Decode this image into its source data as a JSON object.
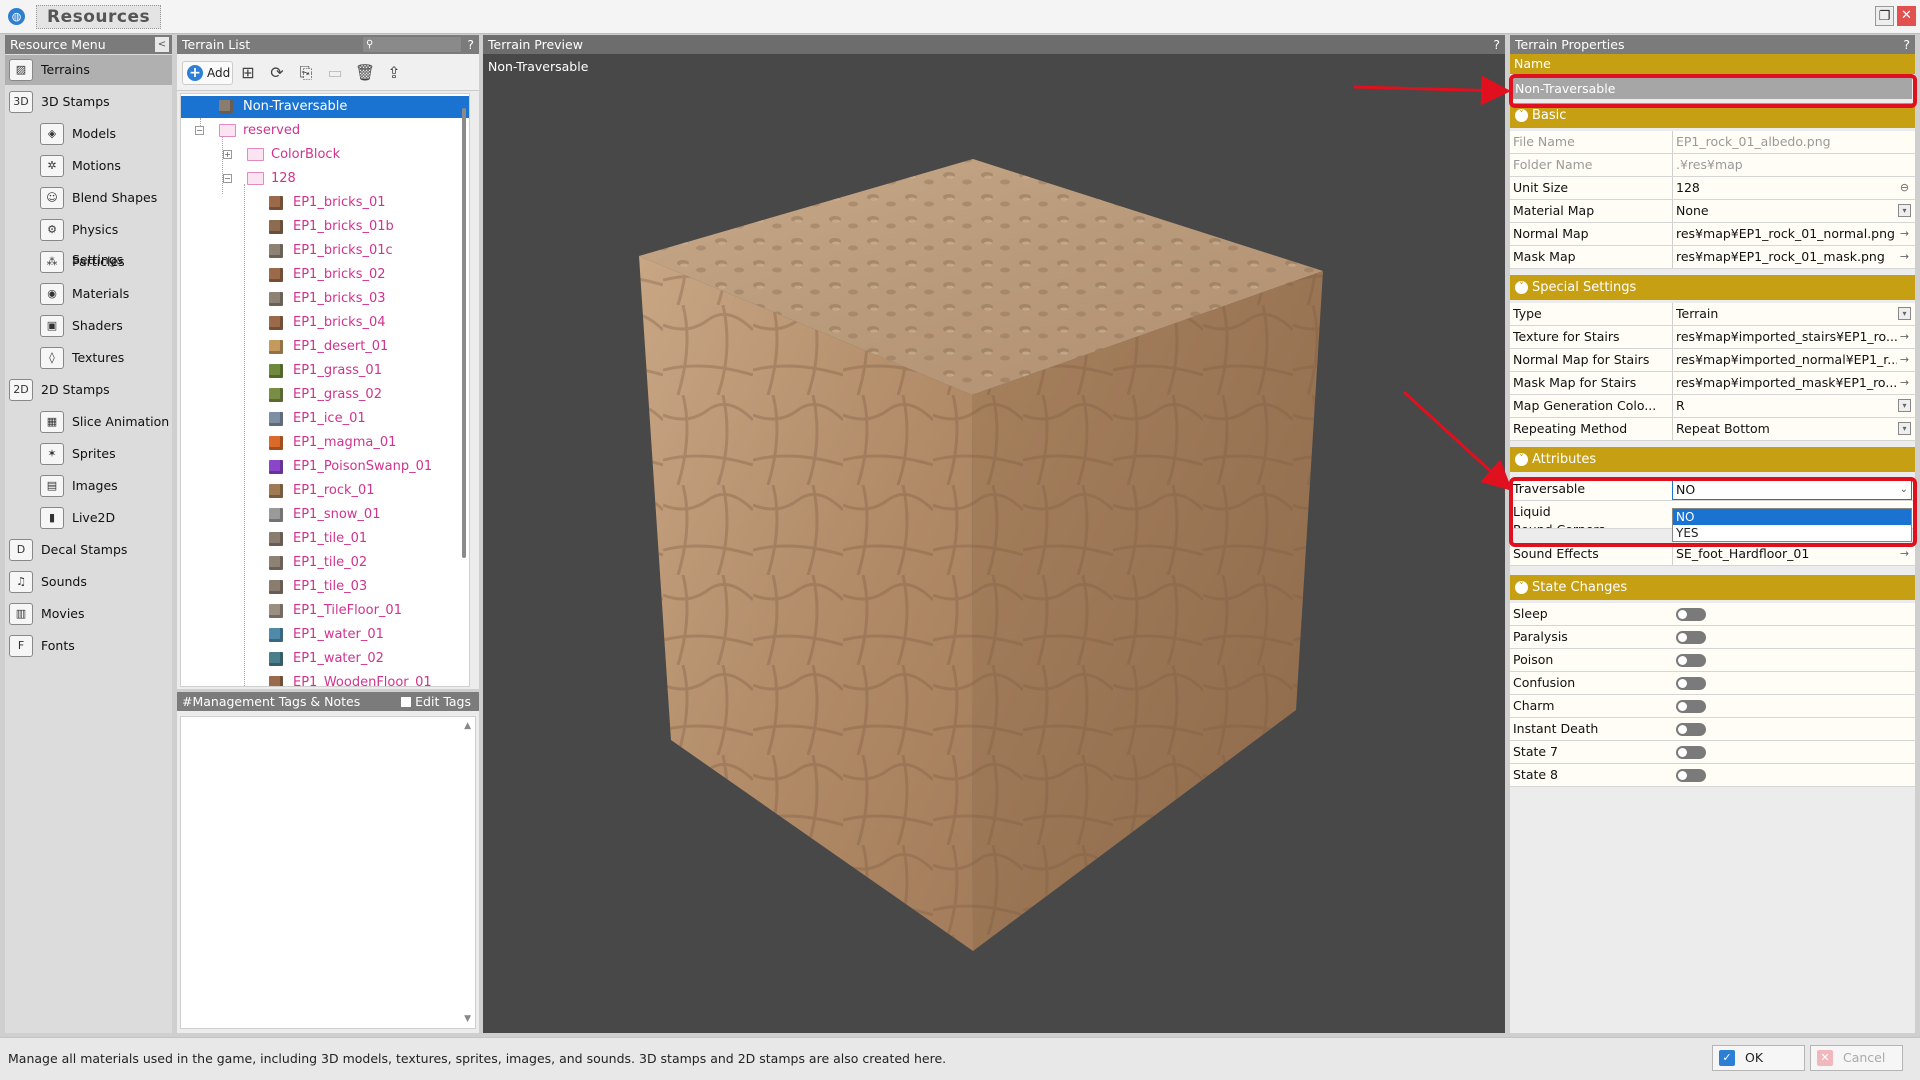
{
  "window": {
    "title": "Resources",
    "app_icon": "globe-icon",
    "restore_icon": "restore-icon",
    "close_icon": "close-icon"
  },
  "resource_menu": {
    "header": "Resource Menu",
    "collapse_glyph": "<",
    "items": [
      {
        "label": "Terrains",
        "glyph": "▨",
        "active": true
      },
      {
        "label": "3D Stamps",
        "glyph": "3D"
      },
      {
        "label": "Models",
        "glyph": "◈"
      },
      {
        "label": "Motions",
        "glyph": "✲"
      },
      {
        "label": "Blend Shapes",
        "glyph": "☺"
      },
      {
        "label": "Physics Settings",
        "glyph": "⚙"
      },
      {
        "label": "Particles",
        "glyph": "⁂"
      },
      {
        "label": "Materials",
        "glyph": "◉"
      },
      {
        "label": "Shaders",
        "glyph": "▣"
      },
      {
        "label": "Textures",
        "glyph": "◊"
      },
      {
        "label": "2D Stamps",
        "glyph": "2D"
      },
      {
        "label": "Slice Animation",
        "glyph": "▦"
      },
      {
        "label": "Sprites",
        "glyph": "✶"
      },
      {
        "label": "Images",
        "glyph": "▤"
      },
      {
        "label": "Live2D",
        "glyph": "▮"
      },
      {
        "label": "Decal Stamps",
        "glyph": "D"
      },
      {
        "label": "Sounds",
        "glyph": "♫"
      },
      {
        "label": "Movies",
        "glyph": "▥"
      },
      {
        "label": "Fonts",
        "glyph": "F"
      }
    ]
  },
  "terrain_list": {
    "header": "Terrain List",
    "help": "?",
    "search_glyph": "⚲",
    "add_label": "Add",
    "add_glyph": "+",
    "toolbar_glyphs": [
      "⊞",
      "⟳",
      "⎘",
      "▭",
      "🗑",
      "⇪"
    ],
    "rows": [
      {
        "label": "Non-Traversable",
        "kind": "item",
        "color": "#8a7d70",
        "selected": true
      },
      {
        "label": "reserved",
        "kind": "folder",
        "expander": "−"
      },
      {
        "label": "ColorBlock",
        "kind": "folder",
        "expander": "+"
      },
      {
        "label": "128",
        "kind": "folder",
        "expander": "−"
      },
      {
        "label": "EP1_bricks_01",
        "kind": "item",
        "color": "#9a6a4a"
      },
      {
        "label": "EP1_bricks_01b",
        "kind": "item",
        "color": "#8d6b50"
      },
      {
        "label": "EP1_bricks_01c",
        "kind": "item",
        "color": "#8e8275"
      },
      {
        "label": "EP1_bricks_02",
        "kind": "item",
        "color": "#9a6a4a"
      },
      {
        "label": "EP1_bricks_03",
        "kind": "item",
        "color": "#8e8275"
      },
      {
        "label": "EP1_bricks_04",
        "kind": "item",
        "color": "#9a6a4a"
      },
      {
        "label": "EP1_desert_01",
        "kind": "item",
        "color": "#c49a5e"
      },
      {
        "label": "EP1_grass_01",
        "kind": "item",
        "color": "#6f8a3c"
      },
      {
        "label": "EP1_grass_02",
        "kind": "item",
        "color": "#7a8d45"
      },
      {
        "label": "EP1_ice_01",
        "kind": "item",
        "color": "#7d8fa3"
      },
      {
        "label": "EP1_magma_01",
        "kind": "item",
        "color": "#d96a2a"
      },
      {
        "label": "EP1_PoisonSwanp_01",
        "kind": "item",
        "color": "#8a45c8"
      },
      {
        "label": "EP1_rock_01",
        "kind": "item",
        "color": "#a07a55"
      },
      {
        "label": "EP1_snow_01",
        "kind": "item",
        "color": "#9a9a9a"
      },
      {
        "label": "EP1_tile_01",
        "kind": "item",
        "color": "#8a7d70"
      },
      {
        "label": "EP1_tile_02",
        "kind": "item",
        "color": "#8e8275"
      },
      {
        "label": "EP1_tile_03",
        "kind": "item",
        "color": "#8a7d70"
      },
      {
        "label": "EP1_TileFloor_01",
        "kind": "item",
        "color": "#9a8f82"
      },
      {
        "label": "EP1_water_01",
        "kind": "item",
        "color": "#4f8aa8"
      },
      {
        "label": "EP1_water_02",
        "kind": "item",
        "color": "#4a7e8a"
      },
      {
        "label": "EP1_WoodenFloor_01",
        "kind": "item",
        "color": "#9a6a4a"
      }
    ]
  },
  "tags_panel": {
    "header": "#Management Tags & Notes",
    "edit_tags_label": "Edit Tags",
    "scroll_up": "▲",
    "scroll_down": "▼"
  },
  "preview": {
    "header": "Terrain Preview",
    "help": "?",
    "label": "Non-Traversable"
  },
  "properties": {
    "header": "Terrain Properties",
    "help": "?",
    "name_label": "Name",
    "name_value": "Non-Traversable",
    "basic": {
      "title": "Basic",
      "rows": [
        {
          "key": "File Name",
          "value": "EP1_rock_01_albedo.png",
          "dim": true
        },
        {
          "key": "Folder Name",
          "value": ".¥res¥map",
          "dim": true
        },
        {
          "key": "Unit Size",
          "value": "128",
          "action": "⊖"
        },
        {
          "key": "Material Map",
          "value": "None",
          "action": "▾"
        },
        {
          "key": "Normal Map",
          "value": "res¥map¥EP1_rock_01_normal.png",
          "action": "→"
        },
        {
          "key": "Mask Map",
          "value": "res¥map¥EP1_rock_01_mask.png",
          "action": "→"
        }
      ]
    },
    "special": {
      "title": "Special Settings",
      "rows": [
        {
          "key": "Type",
          "value": "Terrain",
          "action": "▾"
        },
        {
          "key": "Texture for Stairs",
          "value": "res¥map¥imported_stairs¥EP1_ro...",
          "action": "→"
        },
        {
          "key": "Normal Map for Stairs",
          "value": "res¥map¥imported_normal¥EP1_r...",
          "action": "→"
        },
        {
          "key": "Mask Map for Stairs",
          "value": "res¥map¥imported_mask¥EP1_ro...",
          "action": "→"
        },
        {
          "key": "Map Generation Colo...",
          "value": "R",
          "action": "▾"
        },
        {
          "key": "Repeating Method",
          "value": "Repeat Bottom",
          "action": "▾"
        }
      ]
    },
    "attributes": {
      "title": "Attributes",
      "traversable_key": "Traversable",
      "traversable_value": "NO",
      "liquid_key": "Liquid",
      "round_corners_key": "Round Corners",
      "sound_key": "Sound Effects",
      "sound_value": "SE_foot_Hardfloor_01",
      "sound_action": "→",
      "dropdown_arrow": "⌄",
      "options": [
        "NO",
        "YES"
      ]
    },
    "state_changes": {
      "title": "State Changes",
      "rows": [
        "Sleep",
        "Paralysis",
        "Poison",
        "Confusion",
        "Charm",
        "Instant Death",
        "State 7",
        "State 8"
      ]
    },
    "section_chevron": "˅"
  },
  "status": {
    "text": "Manage all materials used in the game, including 3D models, textures, sprites, images, and sounds. 3D stamps and 2D stamps are also created here.",
    "ok_label": "OK",
    "ok_glyph": "✓",
    "cancel_label": "Cancel",
    "cancel_glyph": "✕"
  },
  "colors": {
    "accent_gold": "#c79f12",
    "selection_blue": "#1a73d1",
    "tree_pink": "#d0338f",
    "annotation_red": "#e0101f"
  }
}
